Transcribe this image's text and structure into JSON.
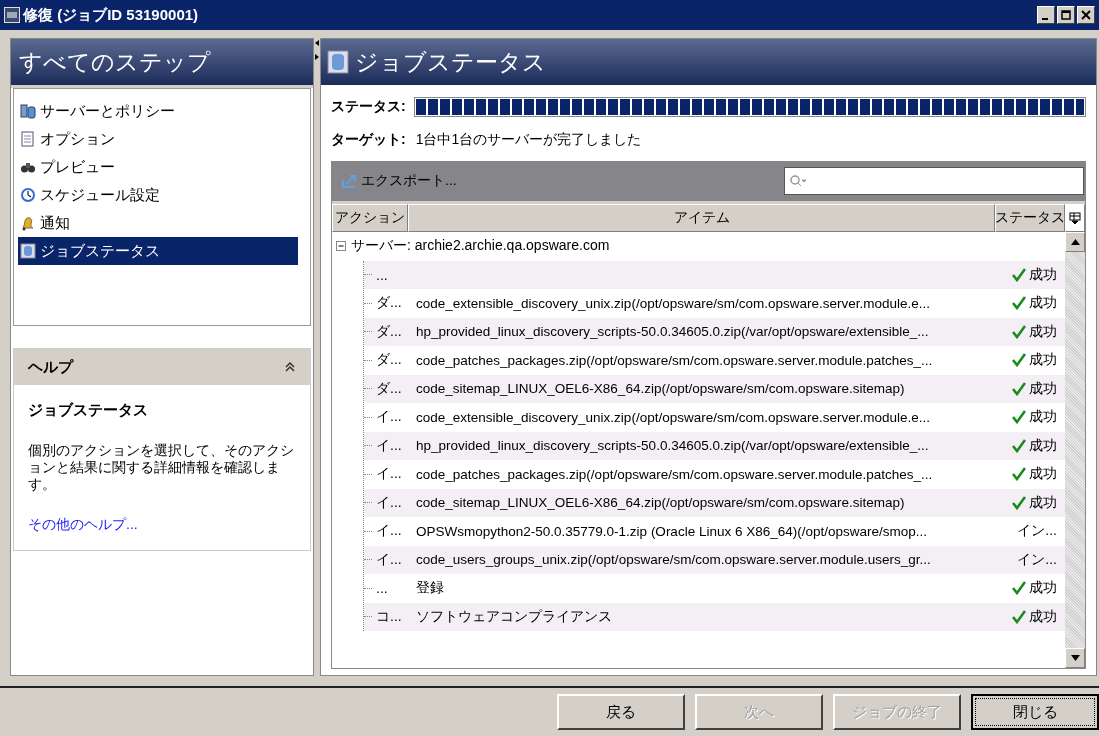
{
  "window": {
    "title": "修復 (ジョブID 53190001)"
  },
  "sidebar": {
    "title": "すべてのステップ",
    "items": [
      {
        "label": "サーバーとポリシー",
        "selected": false
      },
      {
        "label": "オプション",
        "selected": false
      },
      {
        "label": "プレビュー",
        "selected": false
      },
      {
        "label": "スケジュール設定",
        "selected": false
      },
      {
        "label": "通知",
        "selected": false
      },
      {
        "label": "ジョブステータス",
        "selected": true
      }
    ]
  },
  "help": {
    "title": "ヘルプ",
    "heading": "ジョブステータス",
    "text": "個別のアクションを選択して、そのアクションと結果に関する詳細情報を確認します。",
    "link": "その他のヘルプ..."
  },
  "main": {
    "title": "ジョブステータス",
    "status_label": "ステータス:",
    "progress": {
      "level": 1.0
    },
    "target_label": "ターゲット:",
    "target_text": "1台中1台のサーバーが完了しました",
    "export": "エクスポート...",
    "table": {
      "columns": [
        "アクション",
        "アイテム",
        "ステータス"
      ],
      "server": {
        "label": "サーバー: archie2.archie.qa.opsware.com",
        "expanded": true
      },
      "rows": [
        {
          "action": "...",
          "item": "",
          "status": "成功",
          "ok": true
        },
        {
          "action": "ダ...",
          "item": "code_extensible_discovery_unix.zip(/opt/opsware/sm/com.opsware.server.module.e...",
          "status": "成功",
          "ok": true
        },
        {
          "action": "ダ...",
          "item": "hp_provided_linux_discovery_scripts-50.0.34605.0.zip(/var/opt/opsware/extensible_...",
          "status": "成功",
          "ok": true
        },
        {
          "action": "ダ...",
          "item": "code_patches_packages.zip(/opt/opsware/sm/com.opsware.server.module.patches_...",
          "status": "成功",
          "ok": true
        },
        {
          "action": "ダ...",
          "item": "code_sitemap_LINUX_OEL6-X86_64.zip(/opt/opsware/sm/com.opsware.sitemap)",
          "status": "成功",
          "ok": true
        },
        {
          "action": "イ...",
          "item": "code_extensible_discovery_unix.zip(/opt/opsware/sm/com.opsware.server.module.e...",
          "status": "成功",
          "ok": true
        },
        {
          "action": "イ...",
          "item": "hp_provided_linux_discovery_scripts-50.0.34605.0.zip(/var/opt/opsware/extensible_...",
          "status": "成功",
          "ok": true
        },
        {
          "action": "イ...",
          "item": "code_patches_packages.zip(/opt/opsware/sm/com.opsware.server.module.patches_...",
          "status": "成功",
          "ok": true
        },
        {
          "action": "イ...",
          "item": "code_sitemap_LINUX_OEL6-X86_64.zip(/opt/opsware/sm/com.opsware.sitemap)",
          "status": "成功",
          "ok": true
        },
        {
          "action": "イ...",
          "item": "OPSWsmopython2-50.0.35779.0-1.zip (Oracle Linux 6 X86_64)(/opt/opsware/smop...",
          "status": "イン...",
          "ok": false
        },
        {
          "action": "イ...",
          "item": "code_users_groups_unix.zip(/opt/opsware/sm/com.opsware.server.module.users_gr...",
          "status": "イン...",
          "ok": false
        },
        {
          "action": "...",
          "item": "登録",
          "status": "成功",
          "ok": true
        },
        {
          "action": "コ...",
          "item": "ソフトウェアコンプライアンス",
          "status": "成功",
          "ok": true
        }
      ]
    }
  },
  "buttons": [
    {
      "label": "戻る",
      "disabled": false,
      "focused": false
    },
    {
      "label": "次へ",
      "disabled": true,
      "focused": false
    },
    {
      "label": "ジョブの終了",
      "disabled": true,
      "focused": false
    },
    {
      "label": "閉じる",
      "disabled": false,
      "focused": true
    }
  ]
}
